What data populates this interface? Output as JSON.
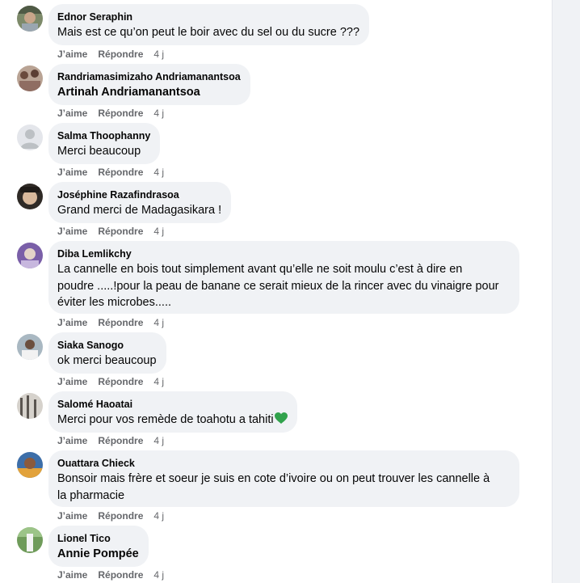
{
  "action_labels": {
    "like": "J’aime",
    "reply": "Répondre"
  },
  "comments": [
    {
      "author": "Ednor Seraphin",
      "text": "Mais est ce qu’on peut le boir avec du sel ou du sucre ???",
      "time": "4 j"
    },
    {
      "author": "Randriamasimizaho Andriamanantsoa",
      "text": "Artinah Andriamanantsoa",
      "time": "4 j"
    },
    {
      "author": "Salma Thoophanny",
      "text": "Merci beaucoup",
      "time": "4 j"
    },
    {
      "author": "Joséphine Razafindrasoa",
      "text": "Grand merci de Madagasikara !",
      "time": "4 j"
    },
    {
      "author": "Diba Lemlikchy",
      "text_lines": [
        "La cannelle en bois tout simplement avant qu’elle ne soit moulu c’est à dire en",
        "poudre .....!pour la peau de banane ce serait mieux de la rincer avec du vinaigre pour",
        "éviter les microbes....."
      ],
      "time": "4 j"
    },
    {
      "author": "Siaka Sanogo",
      "text": "ok merci beaucoup",
      "time": "4 j"
    },
    {
      "author": "Salomé Haoatai",
      "text": "Merci pour vos remède de toahotu a tahiti",
      "emoji": "green-heart",
      "time": "4 j"
    },
    {
      "author": "Ouattara Chieck",
      "text_lines": [
        "Bonsoir mais frère et soeur je suis en cote d’ivoire ou on peut trouver les cannelle à",
        "la pharmacie"
      ],
      "time": "4 j"
    },
    {
      "author": "Lionel Tico",
      "text": "Annie Pompée",
      "time": "4 j"
    }
  ],
  "colors": {
    "bubble": "#f0f2f5",
    "text": "#050505",
    "secondary": "#65676b",
    "heart": "#31a24c"
  }
}
